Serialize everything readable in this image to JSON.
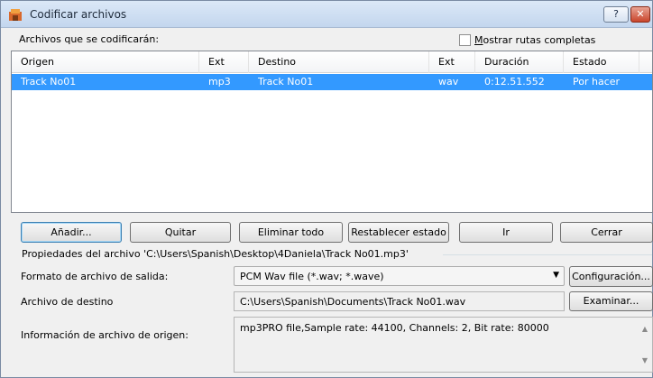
{
  "window": {
    "title": "Codificar archivos",
    "help_label": "?",
    "close_label": "✕"
  },
  "files": {
    "label": "Archivos que se codificarán:",
    "show_paths_label": "Mostrar rutas completas",
    "show_paths_checked": false,
    "columns": [
      "Origen",
      "Ext",
      "Destino",
      "Ext",
      "Duración",
      "Estado"
    ],
    "rows": [
      {
        "origen": "Track No01",
        "ext1": "mp3",
        "destino": "Track No01",
        "ext2": "wav",
        "duracion": "0:12.51.552",
        "estado": "Por hacer",
        "selected": true
      }
    ]
  },
  "buttons": {
    "add": "Añadir...",
    "remove": "Quitar",
    "remove_all": "Eliminar todo",
    "reset": "Restablecer estado",
    "go": "Ir",
    "close": "Cerrar"
  },
  "properties": {
    "label": "Propiedades del archivo 'C:\\Users\\Spanish\\Desktop\\4Daniela\\Track No01.mp3'",
    "output_format_label": "Formato de archivo de salida:",
    "output_format_value": "PCM Wav file (*.wav; *.wave)",
    "config_button": "Configuración...",
    "dest_label": "Archivo de destino",
    "dest_value": "C:\\Users\\Spanish\\Documents\\Track No01.wav",
    "browse_button": "Examinar...",
    "info_label": "Información de archivo de origen:",
    "info_value": "mp3PRO file,Sample rate: 44100, Channels: 2, Bit rate: 80000"
  },
  "colors": {
    "selection": "#3399ff",
    "titlebar": "#c3d6ee",
    "close_button": "#c9452c"
  }
}
